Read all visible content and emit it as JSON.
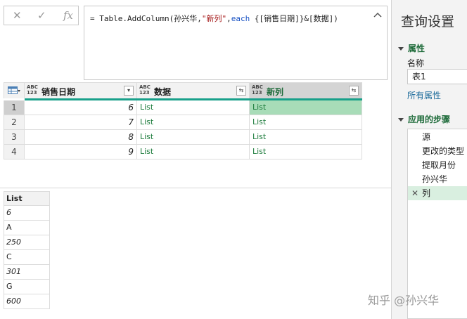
{
  "formula_bar": {
    "cancel_icon": "✕",
    "commit_icon": "✓",
    "fx_label": "fx",
    "formula_parts": [
      {
        "text": "= Table.AddColumn(孙兴华,",
        "cls": ""
      },
      {
        "text": "\"新列\"",
        "cls": "str"
      },
      {
        "text": ",",
        "cls": ""
      },
      {
        "text": "each",
        "cls": "kw"
      },
      {
        "text": " {[销售日期]}&[数据])",
        "cls": ""
      }
    ],
    "collapse_icon": "chevron-up-icon"
  },
  "grid": {
    "type_icon_top": "ABC",
    "type_icon_bottom": "123",
    "columns": [
      {
        "label": "销售日期",
        "filter_icon": "▾"
      },
      {
        "label": "数据",
        "filter_icon": "⇆"
      },
      {
        "label": "新列",
        "filter_icon": "⇆"
      }
    ],
    "rows": [
      {
        "n": "1",
        "date": "6",
        "data": "List",
        "new": "List"
      },
      {
        "n": "2",
        "date": "7",
        "data": "List",
        "new": "List"
      },
      {
        "n": "3",
        "date": "8",
        "data": "List",
        "new": "List"
      },
      {
        "n": "4",
        "date": "9",
        "data": "List",
        "new": "List"
      }
    ],
    "accent": "#18a08a",
    "selected_column_color": "#a8dcb8"
  },
  "preview_list": {
    "header": "List",
    "items": [
      "6",
      "A",
      "250",
      "C",
      "301",
      "G",
      "600"
    ]
  },
  "panel": {
    "title": "查询设置",
    "properties_section": "属性",
    "name_label": "名称",
    "name_value": "表1",
    "all_properties_link": "所有属性",
    "steps_section": "应用的步骤",
    "steps": [
      "源",
      "更改的类型",
      "提取月份",
      "孙兴华",
      "列"
    ],
    "active_step_index": 4
  },
  "watermark": "知乎 @孙兴华"
}
